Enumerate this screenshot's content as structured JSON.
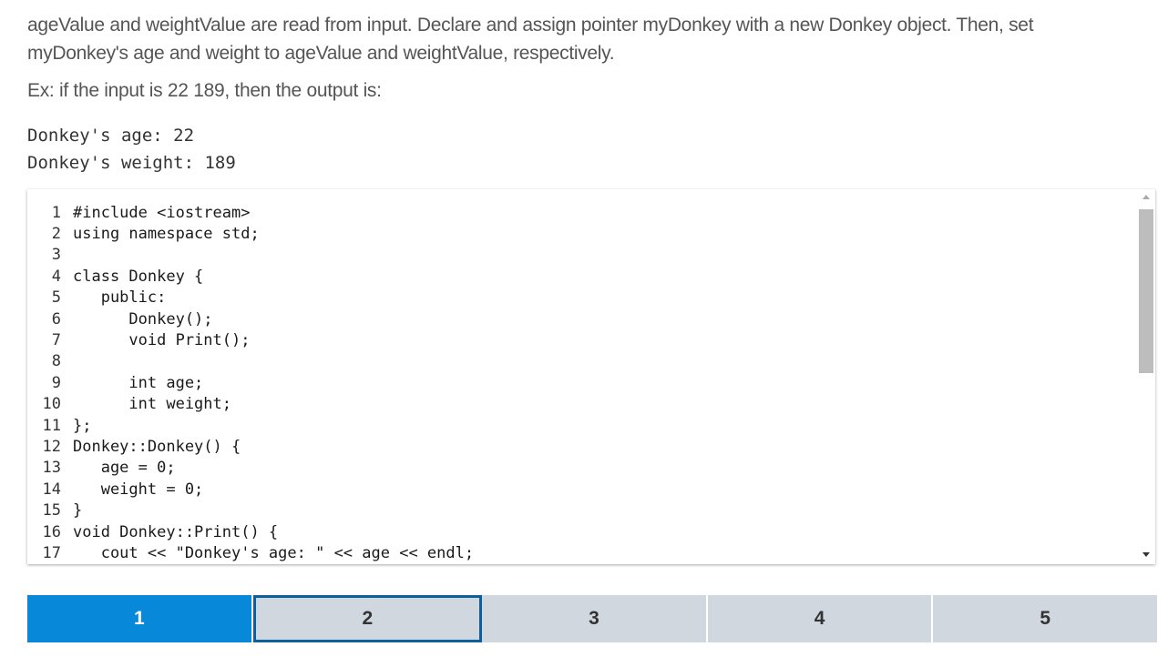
{
  "instructions": {
    "prompt": "ageValue and weightValue are read from input. Declare and assign pointer myDonkey with a new Donkey object. Then, set myDonkey's age and weight to ageValue and weightValue, respectively.",
    "example": "Ex: if the input is 22 189, then the output is:",
    "output_lines": [
      "Donkey's age: 22",
      "Donkey's weight: 189"
    ]
  },
  "editor": {
    "line_numbers": [
      "1",
      "2",
      "3",
      "4",
      "5",
      "6",
      "7",
      "8",
      "9",
      "10",
      "11",
      "12",
      "13",
      "14",
      "15",
      "16",
      "17"
    ],
    "code_lines": [
      "#include <iostream>",
      "using namespace std;",
      "",
      "class Donkey {",
      "   public:",
      "      Donkey();",
      "      void Print();",
      "",
      "      int age;",
      "      int weight;",
      "};",
      "Donkey::Donkey() {",
      "   age = 0;",
      "   weight = 0;",
      "}",
      "void Donkey::Print() {",
      "   cout << \"Donkey's age: \" << age << endl;"
    ]
  },
  "progress": {
    "steps": [
      {
        "label": "1",
        "state": "done"
      },
      {
        "label": "2",
        "state": "current"
      },
      {
        "label": "3",
        "state": "pending"
      },
      {
        "label": "4",
        "state": "pending"
      },
      {
        "label": "5",
        "state": "pending"
      }
    ]
  },
  "colors": {
    "done": "#0788d8",
    "current_border": "#0d5e99",
    "pending": "#d0d7de"
  }
}
